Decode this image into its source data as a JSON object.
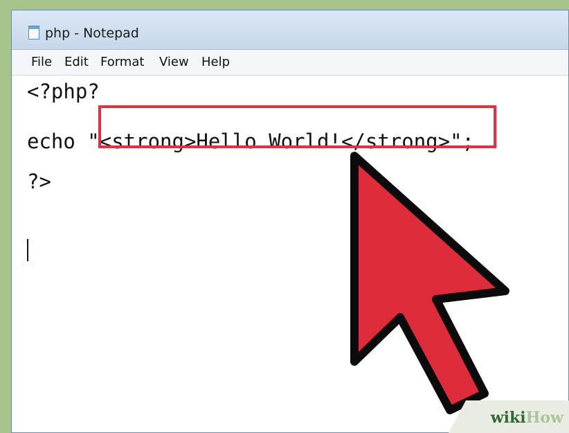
{
  "window": {
    "title": "php - Notepad"
  },
  "menu": {
    "items": [
      "File",
      "Edit",
      "Format",
      "View",
      "Help"
    ]
  },
  "editor": {
    "lines": [
      "<?php?",
      "echo \"<strong>Hello World!</strong>\";",
      "?>"
    ]
  },
  "watermark": {
    "wiki": "wiki",
    "how": "How"
  },
  "colors": {
    "highlight": "#e23240",
    "cursor_fill": "#df2c3b",
    "cursor_outline": "#0b0b0b"
  },
  "icons": {
    "app": "notepad-icon",
    "pointer": "mouse-pointer-icon"
  }
}
